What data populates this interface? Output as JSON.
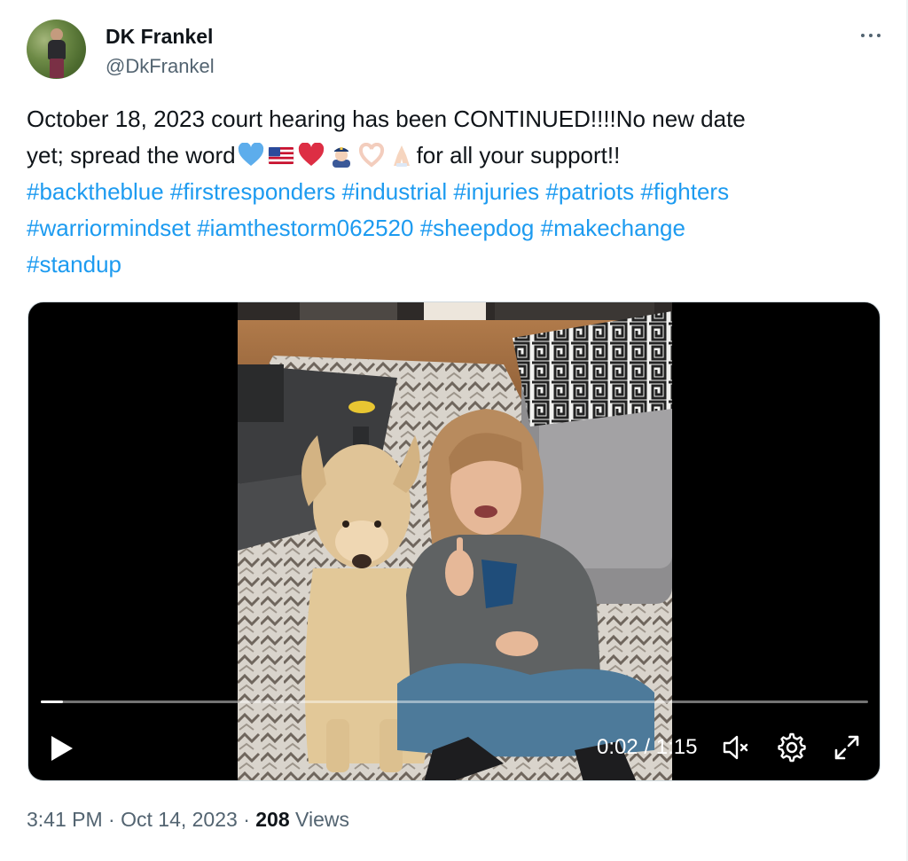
{
  "author": {
    "display_name": "DK Frankel",
    "handle": "@DkFrankel"
  },
  "more_menu": {
    "icon": "more-horizontal-icon"
  },
  "tweet": {
    "text_line_1": "October 18, 2023 court hearing has been CONTINUED!!!!No new date",
    "text_line_2_prefix": "yet; spread the word",
    "text_line_2_suffix": "for all your support!!",
    "emojis": [
      "blue-heart-icon",
      "us-flag-icon",
      "red-heart-icon",
      "police-officer-icon",
      "heart-hands-icon",
      "folded-hands-icon"
    ],
    "hashtags": [
      "#backtheblue",
      "#firstresponders",
      "#industrial",
      "#injuries",
      "#patriots",
      "#fighters",
      "#warriormindset",
      "#iamthestorm062520",
      "#sheepdog",
      "#makechange",
      "#standup"
    ]
  },
  "video": {
    "current_time": "0:02",
    "duration": "1:15",
    "time_display": "0:02 / 1:15",
    "progress_fraction": 0.027,
    "controls": {
      "play": "play-icon",
      "mute": "muted-speaker-icon",
      "settings": "gear-icon",
      "fullscreen": "fullscreen-icon"
    }
  },
  "footer": {
    "time": "3:41 PM",
    "separator": "·",
    "date": "Oct 14, 2023",
    "views_count": "208",
    "views_label": "Views"
  },
  "colors": {
    "link": "#1d9bf0",
    "text": "#0f1419",
    "secondary": "#536471"
  }
}
